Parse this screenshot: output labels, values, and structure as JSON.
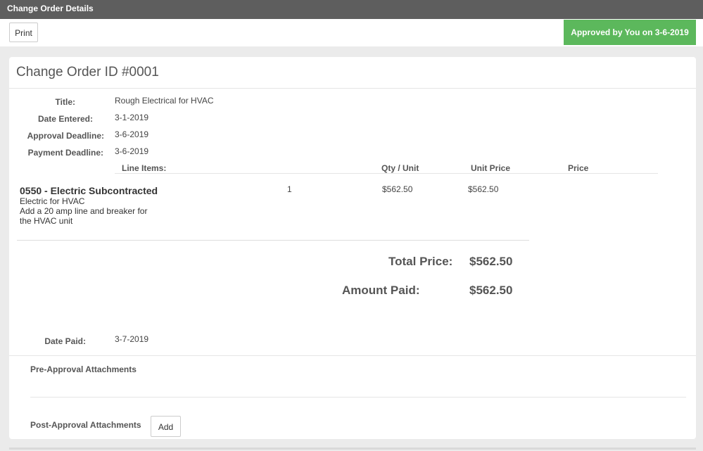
{
  "window": {
    "title": "Change Order Details"
  },
  "toolbar": {
    "print_label": "Print",
    "status_text": "Approved by You on 3-6-2019"
  },
  "colors": {
    "status_green": "#5cb85c",
    "header_gray": "#5e5e5e"
  },
  "order": {
    "heading": "Change Order ID #0001",
    "fields": {
      "title_label": "Title:",
      "title_value": "Rough Electrical for HVAC",
      "date_entered_label": "Date Entered:",
      "date_entered_value": "3-1-2019",
      "approval_deadline_label": "Approval Deadline:",
      "approval_deadline_value": "3-6-2019",
      "payment_deadline_label": "Payment Deadline:",
      "payment_deadline_value": "3-6-2019",
      "date_paid_label": "Date Paid:",
      "date_paid_value": "3-7-2019"
    },
    "line_items": {
      "headers": {
        "items": "Line Items:",
        "qty_unit": "Qty / Unit",
        "unit_price": "Unit Price",
        "price": "Price"
      },
      "rows": [
        {
          "name": "0550 - Electric Subcontracted",
          "desc_line1": "Electric for HVAC",
          "desc_line2": "Add a 20 amp line and breaker for the HVAC unit",
          "qty": "1",
          "qty_unit_value": "$562.50",
          "unit_price_value": "$562.50"
        }
      ]
    },
    "totals": {
      "total_price_label": "Total Price:",
      "total_price_value": "$562.50",
      "amount_paid_label": "Amount Paid:",
      "amount_paid_value": "$562.50"
    },
    "attachments": {
      "pre_label": "Pre-Approval Attachments",
      "post_label": "Post-Approval Attachments",
      "add_label": "Add"
    }
  }
}
